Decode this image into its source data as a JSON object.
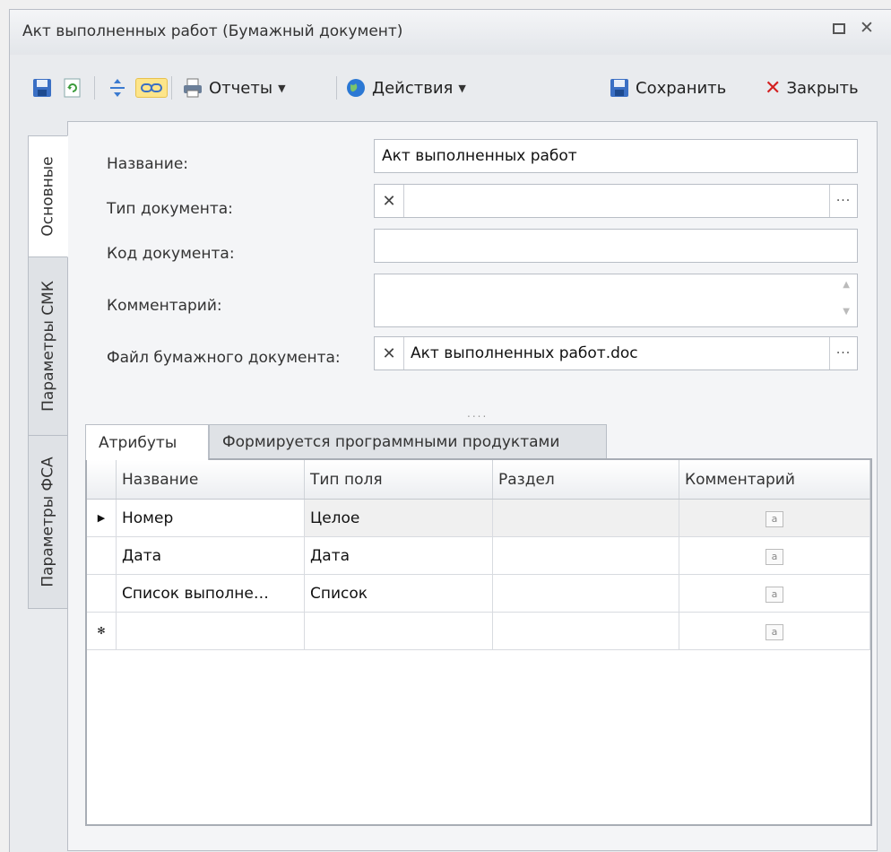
{
  "window": {
    "title": "Акт выполненных работ (Бумажный документ)"
  },
  "toolbar": {
    "reports_label": "Отчеты",
    "actions_label": "Действия",
    "save_label": "Сохранить",
    "close_label": "Закрыть"
  },
  "side_tabs": [
    "Основные",
    "Параметры СМК",
    "Параметры ФСА"
  ],
  "form": {
    "name_label": "Название:",
    "name_value": "Акт выполненных работ",
    "doc_type_label": "Тип документа:",
    "doc_type_value": "",
    "doc_code_label": "Код документа:",
    "doc_code_value": "",
    "comment_label": "Комментарий:",
    "comment_value": "",
    "file_label": "Файл бумажного документа:",
    "file_value": "Акт выполненных работ.doc"
  },
  "inner_tabs": [
    "Атрибуты",
    "Формируется программными продуктами"
  ],
  "grid": {
    "columns": [
      "Название",
      "Тип поля",
      "Раздел",
      "Комментарий"
    ],
    "rows": [
      {
        "name": "Номер",
        "type": "Целое",
        "section": ""
      },
      {
        "name": "Дата",
        "type": "Дата",
        "section": ""
      },
      {
        "name": "Список выполне…",
        "type": "Список",
        "section": ""
      }
    ],
    "memo_glyph": "a"
  },
  "icons": [
    "save-icon",
    "refresh-icon",
    "move-icon",
    "link-icon",
    "printer-icon",
    "globe-icon",
    "save-icon",
    "close-icon"
  ]
}
